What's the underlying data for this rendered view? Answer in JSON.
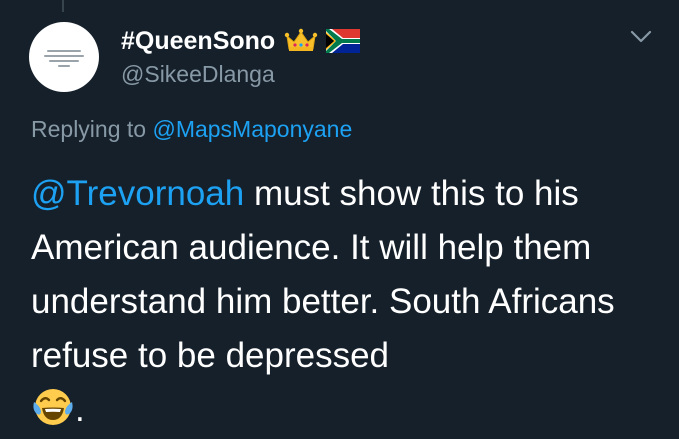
{
  "tweet": {
    "display_name": "#QueenSono",
    "handle": "@SikeeDlanga",
    "replying_prefix": "Replying to",
    "replying_to": "@MapsMaponyane",
    "mention": "@Trevornoah",
    "body": " must show this to his American audience. It will help them understand him better. South Africans refuse to be depressed",
    "trailing": ".",
    "emoji": "face-with-tears-of-joy",
    "badges": [
      "crown-icon",
      "south-africa-flag-icon"
    ],
    "menu_icon": "chevron-down-icon"
  },
  "theme": {
    "background": "#15202b",
    "text": "#ffffff",
    "secondary": "#8899a6",
    "link": "#1da1f2"
  }
}
